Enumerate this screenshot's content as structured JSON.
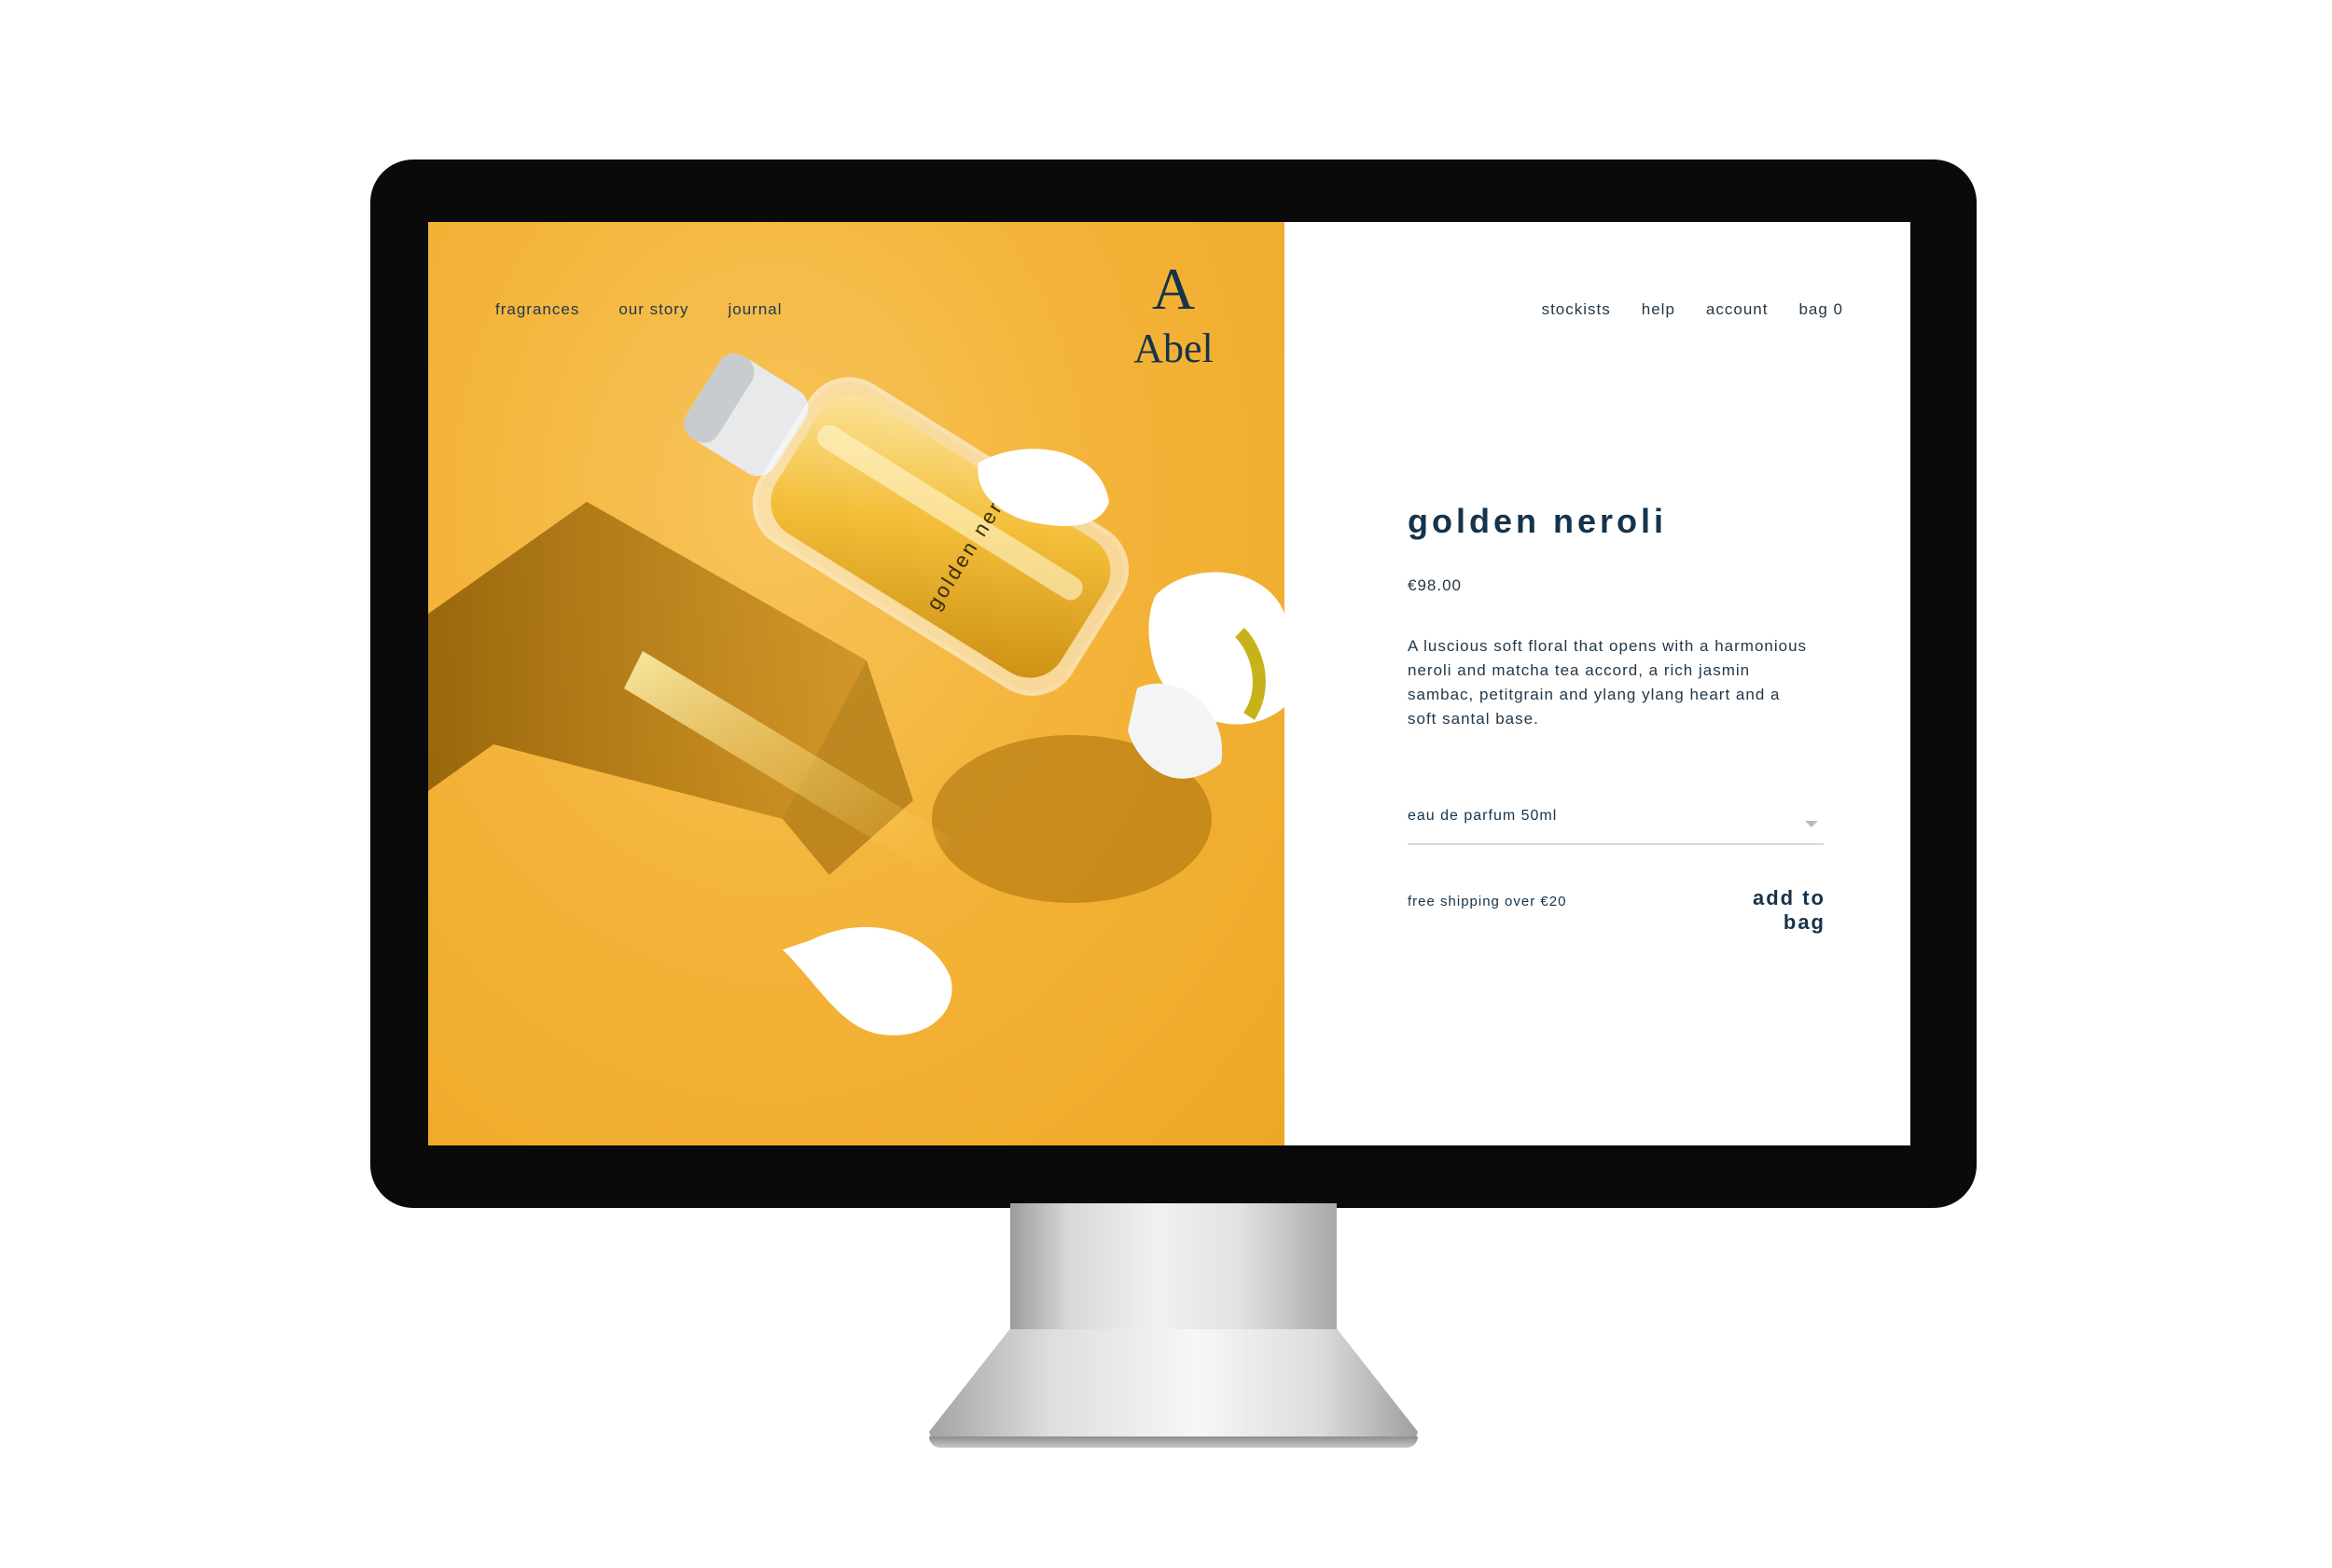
{
  "nav": {
    "left": [
      "fragrances",
      "our story",
      "journal"
    ],
    "right": [
      "stockists",
      "help",
      "account",
      "bag 0"
    ]
  },
  "brand": {
    "mark": "A",
    "name": "Abel"
  },
  "product": {
    "bottle_label": "golden neroli",
    "title": "golden neroli",
    "price": "€98.00",
    "description": "A luscious soft floral that opens with a harmonious neroli and matcha tea accord, a rich jasmin sambac, petitgrain and ylang ylang heart and a soft santal base.",
    "size_selected": "eau de parfum 50ml",
    "shipping_note": "free shipping over €20",
    "add_label": "add to bag"
  },
  "colors": {
    "accent": "#15334b",
    "hero_bg": "#f4b43a",
    "monitor": "#0a0a0a"
  },
  "icons": {
    "select_arrow": "chevron-down-icon"
  }
}
